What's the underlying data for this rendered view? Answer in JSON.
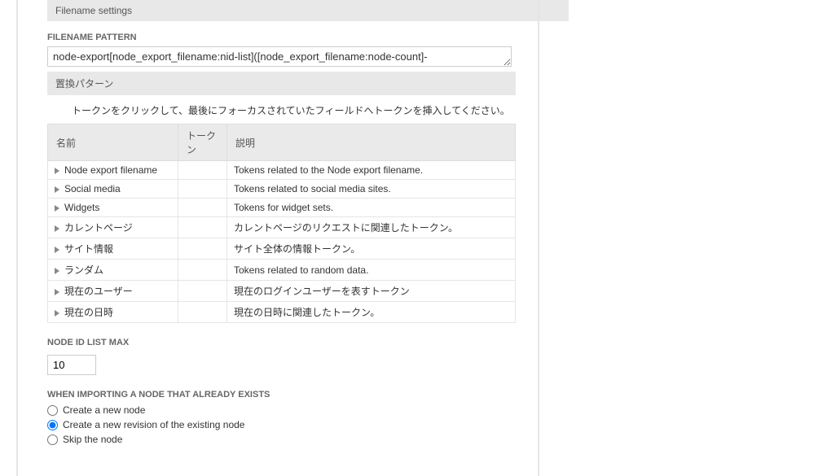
{
  "section_title": "Filename settings",
  "filename_pattern": {
    "label": "Filename pattern",
    "value": "node-export[node_export_filename:nid-list]([node_export_filename:node-count]-"
  },
  "replacement_section": "置換パターン",
  "token_intro": "トークンをクリックして、最後にフォーカスされていたフィールドへトークンを挿入してください。",
  "token_headers": {
    "name": "名前",
    "token": "トークン",
    "desc": "説明"
  },
  "tokens": [
    {
      "name": "Node export filename",
      "desc": "Tokens related to the Node export filename."
    },
    {
      "name": "Social media",
      "desc": "Tokens related to social media sites."
    },
    {
      "name": "Widgets",
      "desc": "Tokens for widget sets."
    },
    {
      "name": "カレントページ",
      "desc": "カレントページのリクエストに関連したトークン。"
    },
    {
      "name": "サイト情報",
      "desc": "サイト全体の情報トークン。"
    },
    {
      "name": "ランダム",
      "desc": "Tokens related to random data."
    },
    {
      "name": "現在のユーザー",
      "desc": "現在のログインユーザーを表すトークン"
    },
    {
      "name": "現在の日時",
      "desc": "現在の日時に関連したトークン。"
    }
  ],
  "node_id_list": {
    "label": "Node ID list max",
    "value": "10"
  },
  "import_existing": {
    "label": "When importing a node that already exists",
    "options": [
      {
        "label": "Create a new node",
        "checked": false
      },
      {
        "label": "Create a new revision of the existing node",
        "checked": true
      },
      {
        "label": "Skip the node",
        "checked": false
      }
    ]
  }
}
